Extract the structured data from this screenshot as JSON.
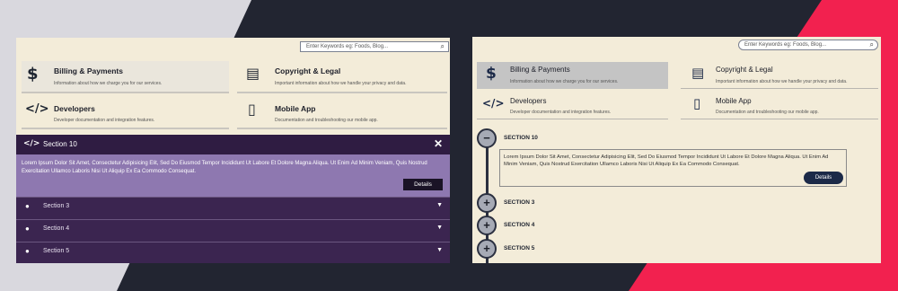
{
  "colors": {
    "dark_bg": "#222531",
    "accent_pink": "#f2214f",
    "panel_bg": "#f3ecd9",
    "purple_dark": "#3b2550",
    "purple_light": "#8e78b0",
    "navy": "#1c2a48"
  },
  "search": {
    "placeholder": "Enter Keywords eg: Foods, Blog..."
  },
  "cards": [
    {
      "icon": "billing-icon",
      "title": "Billing & Payments",
      "desc": "Information about how we charge you for our services."
    },
    {
      "icon": "copyright-icon",
      "title": "Copyright & Legal",
      "desc": "Important information about how we handle your privacy and data."
    },
    {
      "icon": "code-icon",
      "title": "Developers",
      "desc": "Developer documentation and integration features."
    },
    {
      "icon": "mobile-icon",
      "title": "Mobile App",
      "desc": "Documentation and troubleshooting our mobile app."
    }
  ],
  "left_accordion": {
    "open_title": "Section 10",
    "body": "Lorem Ipsum Dolor Sit Amet, Consectetur Adipisicing Elit, Sed Do Eiusmod Tempor Incididunt Ut Labore Et Dolore Magna Aliqua. Ut Enim Ad Minim Veniam, Quis Nostrud Exercitation Ullamco Laboris Nisi Ut Aliquip Ex Ea Commodo Consequat.",
    "details": "Details",
    "rows": [
      "Section 3",
      "Section 4",
      "Section 5"
    ]
  },
  "right_timeline": {
    "open_title": "SECTION 10",
    "body": "Lorem Ipsum Dolor Sit Amet, Consectetur Adipisicing Elit, Sed Do Eiusmod Tempor Incididunt Ut Labore Et Dolore Magna Aliqua. Ut Enim Ad Minim Veniam, Quis Nostrud Exercitation Ullamco Laboris Nisi Ut Aliquip Ex Ea Commodo Consequat.",
    "details": "Details",
    "rows": [
      "SECTION 3",
      "SECTION 4",
      "SECTION 5"
    ],
    "minus": "−",
    "plus": "+"
  }
}
